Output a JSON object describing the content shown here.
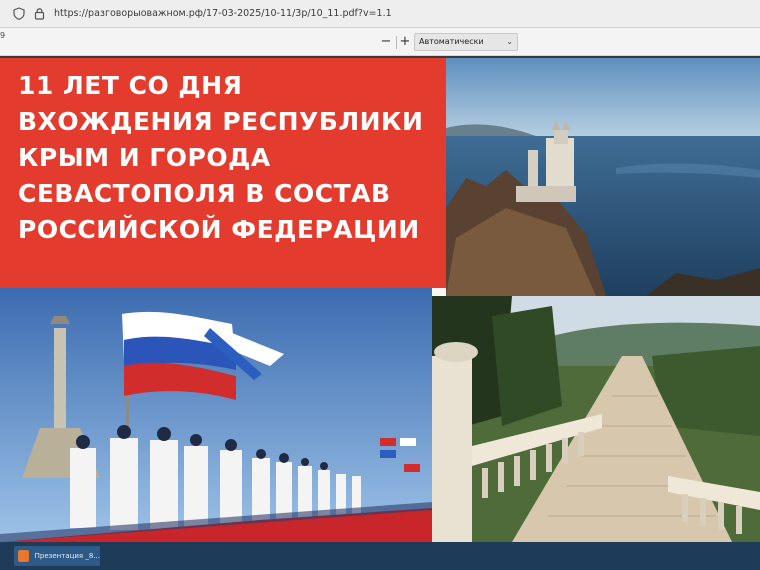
{
  "browser": {
    "url": "https://разговорыоважном.рф/17-03-2025/10-11/3p/10_11.pdf?v=1.1",
    "shield_icon": "shield-icon",
    "lock_icon": "lock-icon"
  },
  "pdf_toolbar": {
    "page_number": "9",
    "zoom_out": "−",
    "zoom_in": "+",
    "zoom_value": "Автоматически"
  },
  "slide": {
    "title_lines": [
      "11 ЛЕТ СО ДНЯ",
      "ВХОЖДЕНИЯ РЕСПУБЛИКИ",
      "КРЫМ И ГОРОДА",
      "СЕВАСТОПОЛЯ В СОСТАВ",
      "РОССИЙСКОЙ ФЕДЕРАЦИИ"
    ],
    "accent_color": "#e33b2e"
  },
  "taskbar": {
    "task_label": "Презентация _8..."
  }
}
